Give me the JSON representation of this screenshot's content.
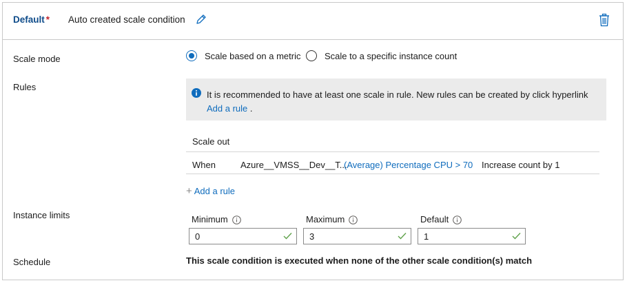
{
  "header": {
    "default_label": "Default",
    "required_mark": "*",
    "condition_name": "Auto created scale condition",
    "edit_icon": "pencil-icon",
    "delete_icon": "trash-icon"
  },
  "scale_mode": {
    "label": "Scale mode",
    "options": [
      {
        "label": "Scale based on a metric",
        "selected": true
      },
      {
        "label": "Scale to a specific instance count",
        "selected": false
      }
    ]
  },
  "rules": {
    "label": "Rules",
    "info_text": "It is recommended to have at least one scale in rule. New rules can be created by click hyperlink",
    "info_link": "Add a rule",
    "info_suffix": ".",
    "table_header": "Scale out",
    "rows": [
      {
        "when": "When",
        "resource": "Azure__VMSS__Dev__T...",
        "condition": "(Average) Percentage CPU > 70",
        "action": "Increase count by 1"
      }
    ],
    "add_rule_label": "Add a rule"
  },
  "instance_limits": {
    "label": "Instance limits",
    "minimum_label": "Minimum",
    "minimum_value": "0",
    "maximum_label": "Maximum",
    "maximum_value": "3",
    "default_label": "Default",
    "default_value": "1"
  },
  "schedule": {
    "label": "Schedule",
    "text": "This scale condition is executed when none of the other scale condition(s) match"
  },
  "colors": {
    "accent": "#0f6cbd",
    "required": "#c4262e",
    "valid_check": "#5fa14a",
    "banner_bg": "#ebebeb"
  }
}
